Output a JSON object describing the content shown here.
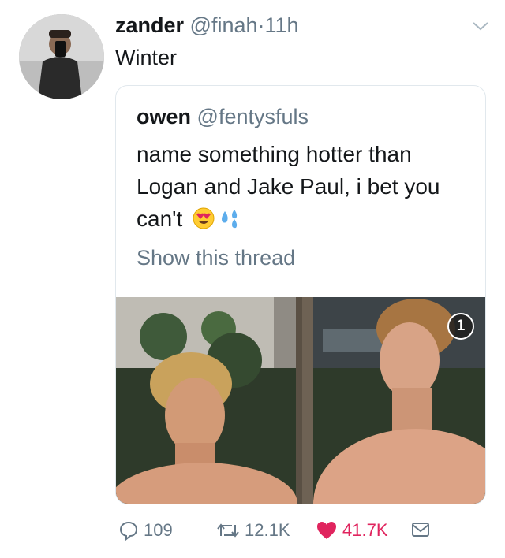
{
  "tweet": {
    "display_name": "zander",
    "handle": "@finah",
    "separator": "·",
    "time": "11h",
    "text": "Winter",
    "avatar_icon": "profile-photo"
  },
  "quoted_tweet": {
    "display_name": "owen",
    "handle": "@fentysfuls",
    "text": "name something hotter than Logan and Jake Paul, i bet you can't",
    "emojis": [
      "heart-eyes-emoji",
      "sweat-droplets-emoji"
    ],
    "show_thread": "Show this thread",
    "photo_badge": "1"
  },
  "actions": {
    "reply_count": "109",
    "retweet_count": "12.1K",
    "like_count": "41.7K",
    "like_color": "#e0245e",
    "muted_color": "#657786"
  }
}
